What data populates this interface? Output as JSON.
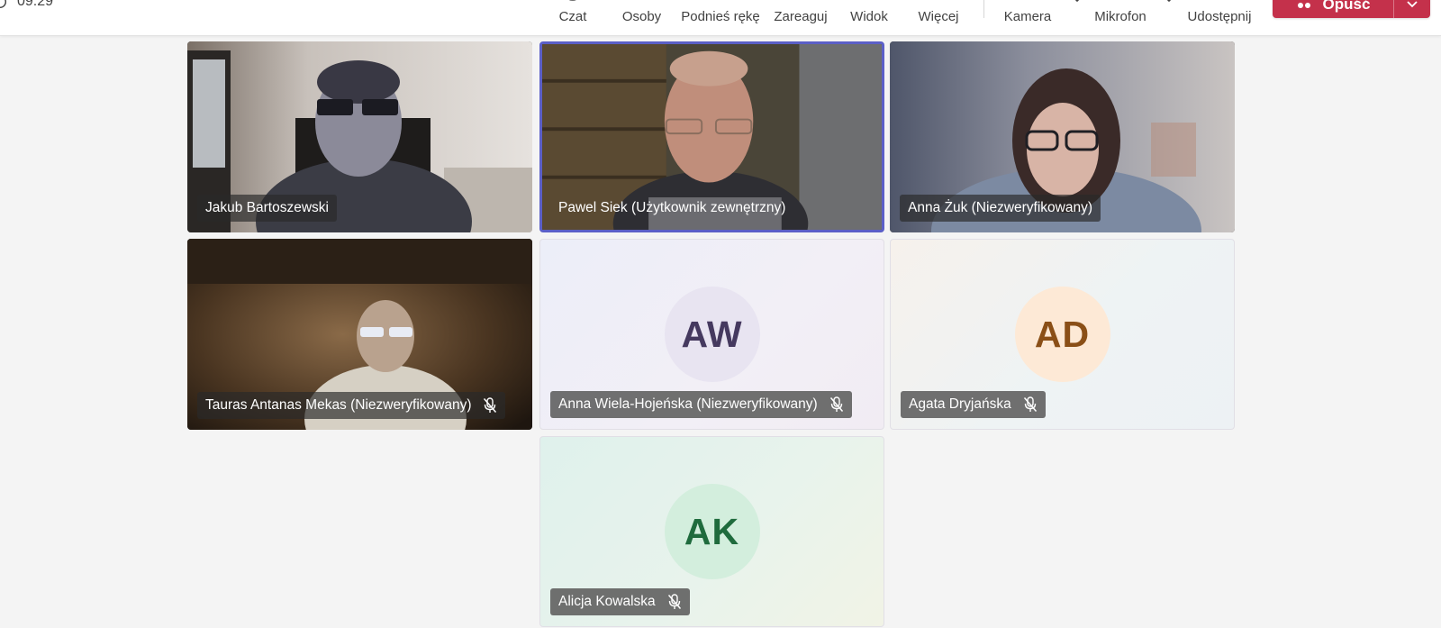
{
  "meeting": {
    "timer": "09:29"
  },
  "toolbar": {
    "chat_label": "Czat",
    "people_label": "Osoby",
    "raise_hand_label": "Podnieś rękę",
    "react_label": "Zareaguj",
    "view_label": "Widok",
    "more_label": "Więcej",
    "camera_label": "Kamera",
    "mic_label": "Mikrofon",
    "share_label": "Udostępnij",
    "leave_label": "Opuść",
    "leave_color": "#c4314b"
  },
  "participants": [
    {
      "name": "Jakub Bartoszewski",
      "type": "video",
      "muted": false
    },
    {
      "name": "Pawel Siek (Użytkownik zewnętrzny)",
      "type": "video",
      "muted": false,
      "active_speaker": true
    },
    {
      "name": "Anna Żuk (Niezweryfikowany)",
      "type": "video",
      "muted": false
    },
    {
      "name": "Tauras Antanas Mekas (Niezweryfikowany)",
      "type": "video",
      "muted": true
    },
    {
      "name": "Anna Wiela-Hojeńska (Niezweryfikowany)",
      "type": "avatar",
      "initials": "AW",
      "muted": true,
      "avatar_bg": "#e8e4f1",
      "avatar_fg": "#45395f"
    },
    {
      "name": "Agata Dryjańska",
      "type": "avatar",
      "initials": "AD",
      "muted": true,
      "avatar_bg": "#fde9d6",
      "avatar_fg": "#8a4f17"
    },
    {
      "name": "Alicja Kowalska",
      "type": "avatar",
      "initials": "AK",
      "muted": true,
      "avatar_bg": "#d3eedd",
      "avatar_fg": "#1f6b3d"
    }
  ],
  "icons": {
    "mic_off": "mic-off-icon",
    "leave": "phone-hangup-icon",
    "dropdown": "chevron-down-icon"
  }
}
